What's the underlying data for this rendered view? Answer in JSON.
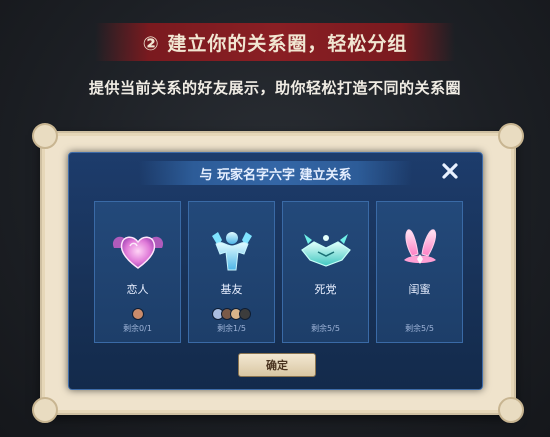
{
  "banner": {
    "title": "② 建立你的关系圈，轻松分组"
  },
  "subtitle": "提供当前关系的好友展示，助你轻松打造不同的关系圈",
  "dialog": {
    "title": "与 玩家名字六字 建立关系",
    "close_icon": "close-icon",
    "confirm_label": "确定",
    "cards": [
      {
        "name": "恋人",
        "icon": "heart-icon",
        "remaining": "剩余0/1",
        "avatars": [
          "#c98b6b"
        ]
      },
      {
        "name": "基友",
        "icon": "muscle-icon",
        "remaining": "剩余1/5",
        "avatars": [
          "#a9bde0",
          "#7a5a48",
          "#d8b48a",
          "#3c3c3c"
        ]
      },
      {
        "name": "死党",
        "icon": "handshake-icon",
        "remaining": "剩余5/5",
        "avatars": []
      },
      {
        "name": "闺蜜",
        "icon": "bunny-ears-icon",
        "remaining": "剩余5/5",
        "avatars": []
      }
    ]
  },
  "colors": {
    "banner_red": "#8a1f24",
    "dialog_blue": "#1d3c6c",
    "heart_pink": "#e07ad8",
    "muscle_cyan": "#7fe3ff",
    "handshake_teal": "#6ff0e8",
    "bunny_pink": "#ff8fd0"
  }
}
